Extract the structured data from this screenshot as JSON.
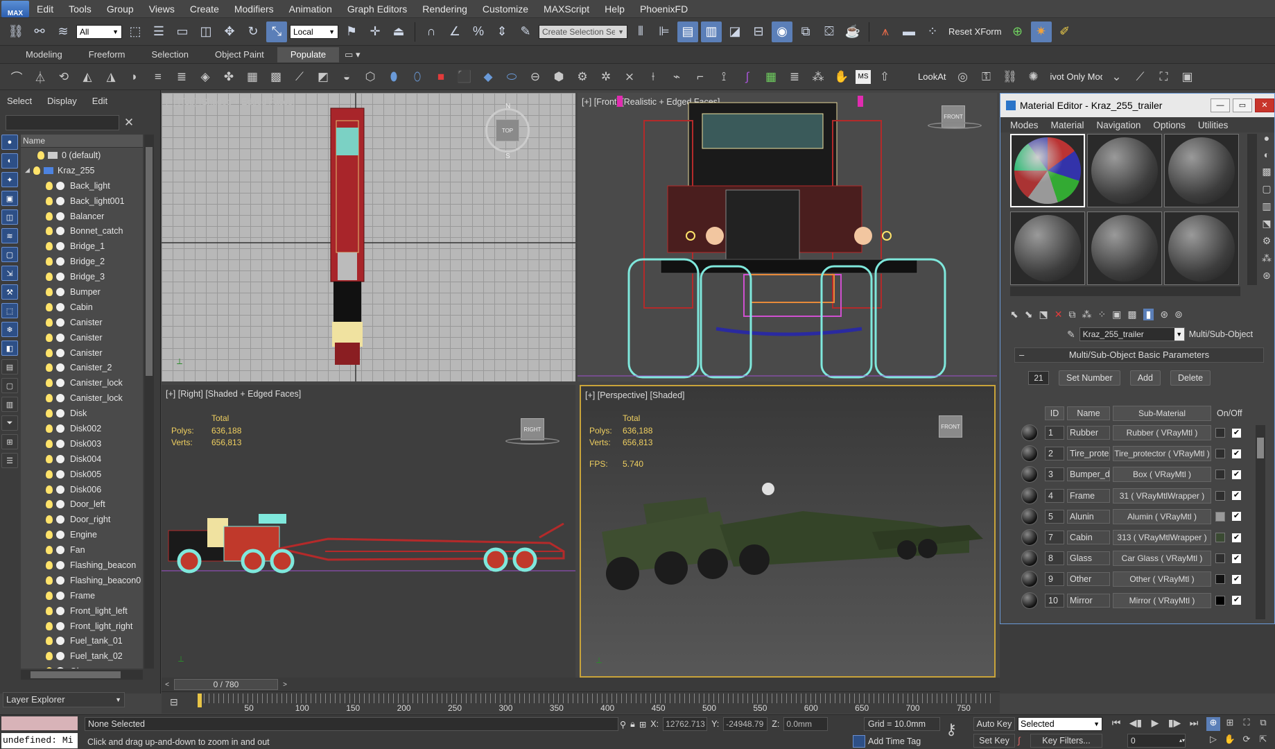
{
  "app": {
    "logo": "MAX"
  },
  "menus": [
    "Edit",
    "Tools",
    "Group",
    "Views",
    "Create",
    "Modifiers",
    "Animation",
    "Graph Editors",
    "Rendering",
    "Customize",
    "MAXScript",
    "Help",
    "PhoenixFD"
  ],
  "toolbar": {
    "selection_filter": "All",
    "ref_coord": "Local",
    "named_selection_placeholder": "Create Selection Se",
    "reset_xform": "Reset XForm"
  },
  "ribbon_tabs": [
    "Modeling",
    "Freeform",
    "Selection",
    "Object Paint",
    "Populate"
  ],
  "toolbar2": {
    "lookat": "LookAt",
    "pivot": "ivot Only Mode"
  },
  "explorer": {
    "menus": [
      "Select",
      "Display",
      "Edit"
    ],
    "column_header": "Name",
    "default_layer": "0 (default)",
    "layer": "Kraz_255",
    "items": [
      "Back_light",
      "Back_light001",
      "Balancer",
      "Bonnet_catch",
      "Bridge_1",
      "Bridge_2",
      "Bridge_3",
      "Bumper",
      "Cabin",
      "Canister",
      "Canister",
      "Canister",
      "Canister_2",
      "Canister_lock",
      "Canister_lock",
      "Disk",
      "Disk002",
      "Disk003",
      "Disk004",
      "Disk005",
      "Disk006",
      "Door_left",
      "Door_right",
      "Engine",
      "Fan",
      "Flashing_beacon",
      "Flashing_beacon0",
      "Frame",
      "Front_light_left",
      "Front_light_right",
      "Fuel_tank_01",
      "Fuel_tank_02",
      "Glass"
    ],
    "footer": "Layer Explorer"
  },
  "viewports": {
    "top": {
      "label": "[+] [Top] [Shaded + Edged Faces]",
      "cube": "TOP",
      "compass_n": "N",
      "compass_s": "S"
    },
    "front": {
      "label": "[+] [Front] [Realistic + Edged Faces]",
      "cube": "FRONT"
    },
    "right": {
      "label": "[+] [Right] [Shaded + Edged Faces]",
      "cube": "RIGHT",
      "stats_total": "Total",
      "polys_label": "Polys:",
      "polys": "636,188",
      "verts_label": "Verts:",
      "verts": "656,813"
    },
    "perspective": {
      "label": "[+] [Perspective] [Shaded]",
      "cube": "FRONT",
      "stats_total": "Total",
      "polys_label": "Polys:",
      "polys": "636,188",
      "verts_label": "Verts:",
      "verts": "656,813",
      "fps_label": "FPS:",
      "fps": "5.740"
    }
  },
  "material_editor": {
    "title": "Material Editor - Kraz_255_trailer",
    "menus": [
      "Modes",
      "Material",
      "Navigation",
      "Options",
      "Utilities"
    ],
    "material_name": "Kraz_255_trailer",
    "material_type": "Multi/Sub-Object",
    "rollout": "Multi/Sub-Object Basic Parameters",
    "count": "21",
    "set_number": "Set Number",
    "add": "Add",
    "delete": "Delete",
    "headers": {
      "id": "ID",
      "name": "Name",
      "sub": "Sub-Material",
      "onoff": "On/Off"
    },
    "rows": [
      {
        "id": "1",
        "name": "Rubber",
        "sub": "Rubber  ( VRayMtl )",
        "color": "#2e2e2e"
      },
      {
        "id": "2",
        "name": "Tire_prote",
        "sub": "Tire_protector  ( VRayMtl )",
        "color": "#2e2e2e"
      },
      {
        "id": "3",
        "name": "Bumper_di",
        "sub": "Box  ( VRayMtl )",
        "color": "#2e2e2e"
      },
      {
        "id": "4",
        "name": "Frame",
        "sub": "31  ( VRayMtlWrapper )",
        "color": "#2e2e2e"
      },
      {
        "id": "5",
        "name": "Alunin",
        "sub": "Alumin  ( VRayMtl )",
        "color": "#9a9a9a"
      },
      {
        "id": "7",
        "name": "Cabin",
        "sub": "313  ( VRayMtlWrapper )",
        "color": "#3a4a32"
      },
      {
        "id": "8",
        "name": "Glass",
        "sub": "Car Glass  ( VRayMtl )",
        "color": "#2e2e2e"
      },
      {
        "id": "9",
        "name": "Other",
        "sub": "Other  ( VRayMtl )",
        "color": "#111111"
      },
      {
        "id": "10",
        "name": "Mirror",
        "sub": "Mirror  ( VRayMtl )",
        "color": "#000000"
      }
    ]
  },
  "timeline": {
    "frame": "0 / 780",
    "ticks": [
      "50",
      "100",
      "150",
      "200",
      "250",
      "300",
      "350",
      "400",
      "450",
      "500",
      "550",
      "600",
      "650",
      "700",
      "750"
    ]
  },
  "status": {
    "script_out": "undefined: Mi",
    "selection": "None Selected",
    "prompt": "Click and drag up-and-down to zoom in and out",
    "x_label": "X:",
    "x": "12762.713",
    "y_label": "Y:",
    "y": "-24948.79",
    "z_label": "Z:",
    "z": "0.0mm",
    "grid": "Grid = 10.0mm",
    "add_time_tag": "Add Time Tag",
    "auto_key": "Auto Key",
    "set_key": "Set Key",
    "key_mode": "Selected",
    "key_filters": "Key Filters...",
    "current_frame": "0"
  }
}
